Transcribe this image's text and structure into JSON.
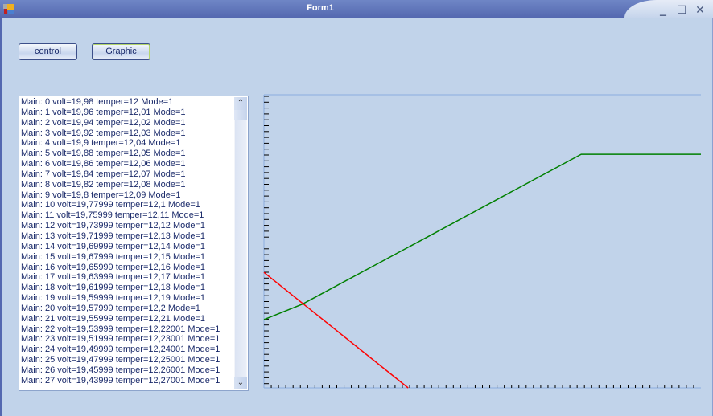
{
  "window": {
    "title": "Form1",
    "minimize": "‗",
    "maximize": "☐",
    "close": "✕"
  },
  "buttons": {
    "control": "control",
    "graphic": "Graphic"
  },
  "log": {
    "items": [
      "Main: 0 volt=19,98 temper=12 Mode=1",
      "Main: 1 volt=19,96 temper=12,01 Mode=1",
      "Main: 2 volt=19,94 temper=12,02 Mode=1",
      "Main: 3 volt=19,92 temper=12,03 Mode=1",
      "Main: 4 volt=19,9 temper=12,04 Mode=1",
      "Main: 5 volt=19,88 temper=12,05 Mode=1",
      "Main: 6 volt=19,86 temper=12,06 Mode=1",
      "Main: 7 volt=19,84 temper=12,07 Mode=1",
      "Main: 8 volt=19,82 temper=12,08 Mode=1",
      "Main: 9 volt=19,8 temper=12,09 Mode=1",
      "Main: 10 volt=19,77999 temper=12,1 Mode=1",
      "Main: 11 volt=19,75999 temper=12,11 Mode=1",
      "Main: 12 volt=19,73999 temper=12,12 Mode=1",
      "Main: 13 volt=19,71999 temper=12,13 Mode=1",
      "Main: 14 volt=19,69999 temper=12,14 Mode=1",
      "Main: 15 volt=19,67999 temper=12,15 Mode=1",
      "Main: 16 volt=19,65999 temper=12,16 Mode=1",
      "Main: 17 volt=19,63999 temper=12,17 Mode=1",
      "Main: 18 volt=19,61999 temper=12,18 Mode=1",
      "Main: 19 volt=19,59999 temper=12,19 Mode=1",
      "Main: 20 volt=19,57999 temper=12,2 Mode=1",
      "Main: 21 volt=19,55999 temper=12,21 Mode=1",
      "Main: 22 volt=19,53999 temper=12,22001 Mode=1",
      "Main: 23 volt=19,51999 temper=12,23001 Mode=1",
      "Main: 24 volt=19,49999 temper=12,24001 Mode=1",
      "Main: 25 volt=19,47999 temper=12,25001 Mode=1",
      "Main: 26 volt=19,45999 temper=12,26001 Mode=1",
      "Main: 27 volt=19,43999 temper=12,27001 Mode=1"
    ]
  },
  "chart_data": {
    "type": "line",
    "xlim": [
      0,
      100
    ],
    "ylim": [
      0,
      100
    ],
    "series": [
      {
        "name": "green",
        "color": "#008000",
        "points": [
          [
            0,
            23.3
          ],
          [
            8.7,
            28.5
          ],
          [
            72.6,
            79.7
          ],
          [
            100,
            79.7
          ]
        ]
      },
      {
        "name": "red",
        "color": "#ff0000",
        "points": [
          [
            0,
            39.4
          ],
          [
            33,
            0
          ]
        ]
      }
    ],
    "y_ticks": 50,
    "x_ticks": 60,
    "grid": false
  }
}
